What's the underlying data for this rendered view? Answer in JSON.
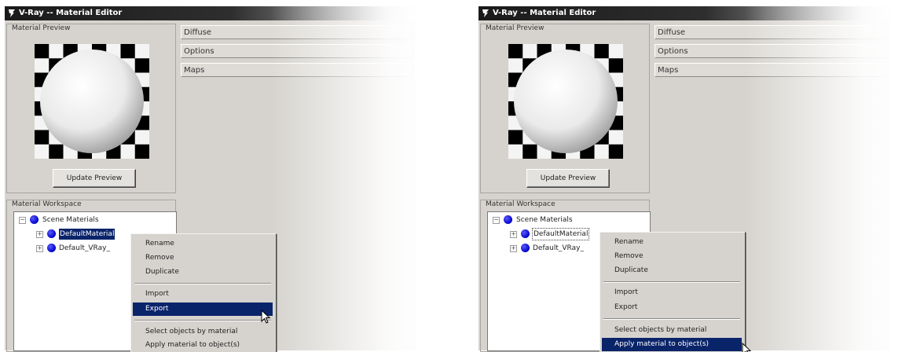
{
  "panels": [
    {
      "window_title": "V-Ray -- Material Editor",
      "preview_group_label": "Material Preview",
      "update_preview_label": "Update Preview",
      "rollouts": [
        "Diffuse",
        "Options",
        "Maps"
      ],
      "workspace_label": "Material Workspace",
      "tree": {
        "root": "Scene Materials",
        "items": [
          "DefaultMaterial",
          "Default_VRay_"
        ]
      },
      "context_menu": {
        "items": [
          "Rename",
          "Remove",
          "Duplicate",
          "Import",
          "Export",
          "Select objects by material",
          "Apply material to object(s)"
        ],
        "highlighted": "Export"
      }
    },
    {
      "window_title": "V-Ray -- Material Editor",
      "preview_group_label": "Material Preview",
      "update_preview_label": "Update Preview",
      "rollouts": [
        "Diffuse",
        "Options",
        "Maps"
      ],
      "workspace_label": "Material Workspace",
      "tree": {
        "root": "Scene Materials",
        "items": [
          "DefaultMaterial",
          "Default_VRay_"
        ]
      },
      "context_menu": {
        "items": [
          "Rename",
          "Remove",
          "Duplicate",
          "Import",
          "Export",
          "Select objects by material",
          "Apply material to object(s)"
        ],
        "highlighted": "Apply material to object(s)"
      }
    }
  ],
  "colors": {
    "selection": "#0a246a",
    "window_face": "#d6d3ce",
    "material_ball": "#0000c8"
  }
}
